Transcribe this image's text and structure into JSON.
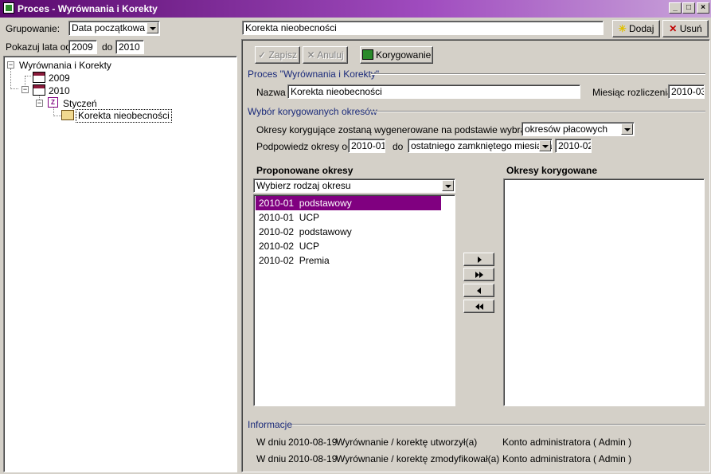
{
  "window": {
    "title": "Proces - Wyrównania i Korekty"
  },
  "left_panel": {
    "grouping_label": "Grupowanie:",
    "grouping_value": "Data początkowa",
    "years_label": "Pokazuj lata od",
    "year_from": "2009",
    "year_to_label": "do",
    "year_to": "2010",
    "tree": {
      "root": "Wyrównania i Korekty",
      "year_2009": "2009",
      "year_2010": "2010",
      "month": "Styczeń",
      "item": "Korekta nieobecności"
    }
  },
  "topbar": {
    "name_value": "Korekta nieobecności",
    "add_label": "Dodaj",
    "delete_label": "Usuń"
  },
  "toolbar": {
    "save_label": "Zapisz",
    "cancel_label": "Anuluj",
    "correct_label": "Korygowanie"
  },
  "process_group": {
    "title": "Proces \"Wyrównania i Korekty\"",
    "name_label": "Nazwa",
    "name_value": "Korekta nieobecności",
    "month_label": "Miesiąc rozliczenia",
    "month_value": "2010-03"
  },
  "periods_group": {
    "title": "Wybór korygowanych okresów",
    "generated_label": "Okresy korygujące zostaną wygenerowane na podstawie wybranych",
    "generated_value": "okresów płacowych",
    "suggest_label": "Podpowiedz okresy od",
    "suggest_from": "2010-01",
    "suggest_to_label": "do",
    "suggest_to_mode": "ostatniego zamkniętego miesiąca",
    "suggest_to_value": "2010-02"
  },
  "proposed": {
    "header": "Proponowane okresy",
    "filter_value": "Wybierz rodzaj okresu",
    "items": [
      {
        "period": "2010-01",
        "type": "podstawowy"
      },
      {
        "period": "2010-01",
        "type": "UCP"
      },
      {
        "period": "2010-02",
        "type": "podstawowy"
      },
      {
        "period": "2010-02",
        "type": "UCP"
      },
      {
        "period": "2010-02",
        "type": "Premia"
      }
    ]
  },
  "corrected": {
    "header": "Okresy korygowane"
  },
  "info": {
    "title": "Informacje",
    "rows": [
      {
        "prefix": "W dniu",
        "date": "2010-08-19",
        "action": "Wyrównanie / korektę utworzył(a)",
        "user": "Konto administratora ( Admin )"
      },
      {
        "prefix": "W dniu",
        "date": "2010-08-19",
        "action": "Wyrównanie / korektę zmodyfikował(a)",
        "user": "Konto administratora ( Admin )"
      }
    ]
  },
  "colors": {
    "title_bar": "#5a0a6e",
    "selection": "#800080",
    "group_title": "#1a2a7a",
    "face": "#d4d0c8"
  }
}
